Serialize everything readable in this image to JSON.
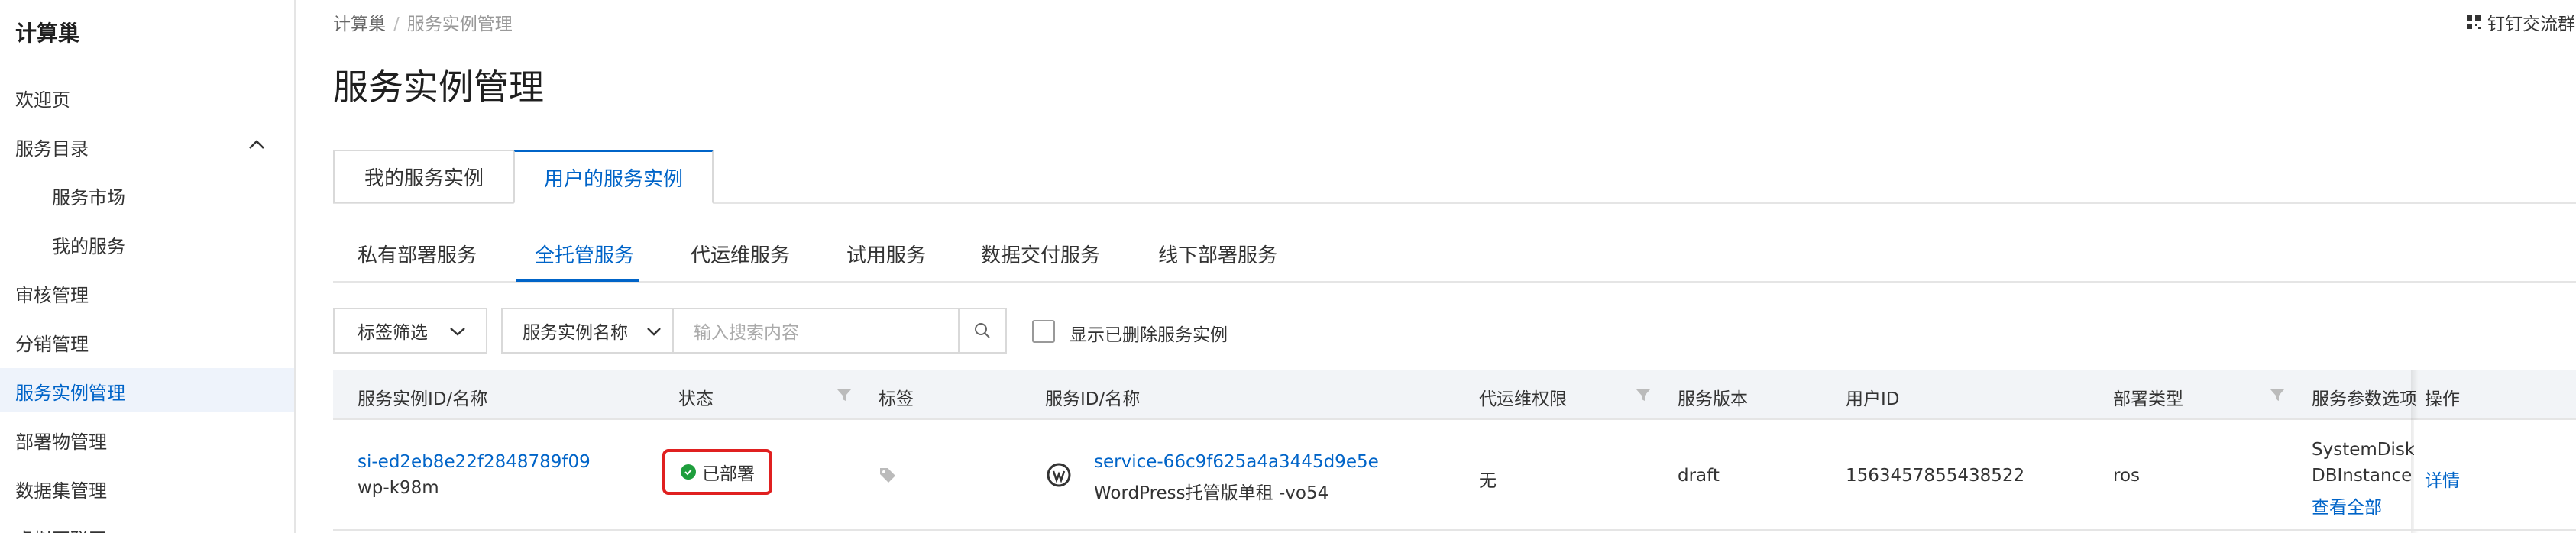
{
  "sidebar": {
    "brand": "计算巢",
    "items": [
      {
        "label": "欢迎页"
      },
      {
        "label": "服务目录"
      },
      {
        "label": "服务市场"
      },
      {
        "label": "我的服务"
      },
      {
        "label": "审核管理"
      },
      {
        "label": "分销管理"
      },
      {
        "label": "服务实例管理"
      },
      {
        "label": "部署物管理"
      },
      {
        "label": "数据集管理"
      },
      {
        "label": "虚拟互联网"
      }
    ]
  },
  "header": {
    "breadcrumb": [
      "计算巢",
      "服务实例管理"
    ],
    "breadcrumb_sep": "/",
    "dingtalk": "钉钉交流群"
  },
  "page_title": "服务实例管理",
  "main_tabs": [
    {
      "label": "我的服务实例"
    },
    {
      "label": "用户的服务实例"
    }
  ],
  "sub_tabs": [
    {
      "label": "私有部署服务"
    },
    {
      "label": "全托管服务"
    },
    {
      "label": "代运维服务"
    },
    {
      "label": "试用服务"
    },
    {
      "label": "数据交付服务"
    },
    {
      "label": "线下部署服务"
    }
  ],
  "filters": {
    "tag_filter": "标签筛选",
    "name_select": "服务实例名称",
    "search_placeholder": "输入搜索内容",
    "show_deleted": "显示已删除服务实例"
  },
  "table": {
    "columns": [
      "服务实例ID/名称",
      "状态",
      "标签",
      "服务ID/名称",
      "代运维权限",
      "服务版本",
      "用户ID",
      "部署类型",
      "服务参数选项",
      "操作"
    ],
    "rows": [
      {
        "instance_id": "si-ed2eb8e22f2848789f09",
        "instance_name": "wp-k98m",
        "status": "已部署",
        "service_id": "service-66c9f625a4a3445d9e5e",
        "service_name": "WordPress托管版单租 -vo54",
        "ops_permission": "无",
        "version": "draft",
        "user_id": "1563457855438522",
        "deploy_type": "ros",
        "params_line1": "SystemDisk",
        "params_line2": "DBInstance",
        "params_more": "查看全部",
        "action": "详情"
      }
    ]
  },
  "colors": {
    "accent": "#0064c8",
    "status_ok": "#1e9e3c",
    "highlight": "#e02020"
  },
  "icons": [
    "chevron-up-icon",
    "chevron-down-icon",
    "search-icon",
    "filter-icon",
    "tag-icon",
    "wordpress-icon",
    "qrcode-icon",
    "check-circle-icon"
  ]
}
